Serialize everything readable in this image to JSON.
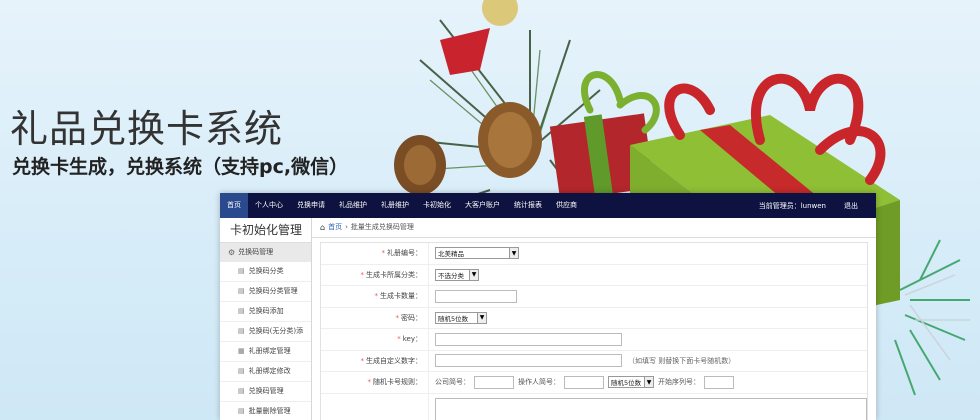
{
  "hero": {
    "title": "礼品兑换卡系统",
    "subtitle": "兑换卡生成，兑换系统（支持pc,微信）"
  },
  "nav": {
    "items": [
      "首页",
      "个人中心",
      "兑换申请",
      "礼品维护",
      "礼册维护",
      "卡初始化",
      "大客户账户",
      "统计报表",
      "供应商"
    ],
    "admin": "当前管理员：lunwen",
    "logout": "退出"
  },
  "sidebar": {
    "title": "卡初始化管理",
    "group": "兑换码管理",
    "items": [
      "兑换码分类",
      "兑换码分类管理",
      "兑换码添加",
      "兑换码(无分类)添",
      "礼册绑定管理",
      "礼册绑定修改",
      "兑换码管理",
      "批量删除管理"
    ]
  },
  "breadcrumb": {
    "home": "首页",
    "current": "批量生成兑换码管理"
  },
  "form": {
    "gift_book": {
      "label": "礼册编号：",
      "value": "北美精品"
    },
    "category": {
      "label": "生成卡所属分类：",
      "value": "不选分类"
    },
    "count": {
      "label": "生成卡数量："
    },
    "password": {
      "label": "密码：",
      "value": "随机5位数"
    },
    "key": {
      "label": "key："
    },
    "custom": {
      "label": "生成自定义数字：",
      "hint": "（如填写 则替换下面卡号随机数）"
    },
    "rule": {
      "label": "随机卡号规则：",
      "company": "公司简号：",
      "operator": "操作人简号：",
      "random": "随机5位数",
      "start": "开始序列号："
    }
  }
}
